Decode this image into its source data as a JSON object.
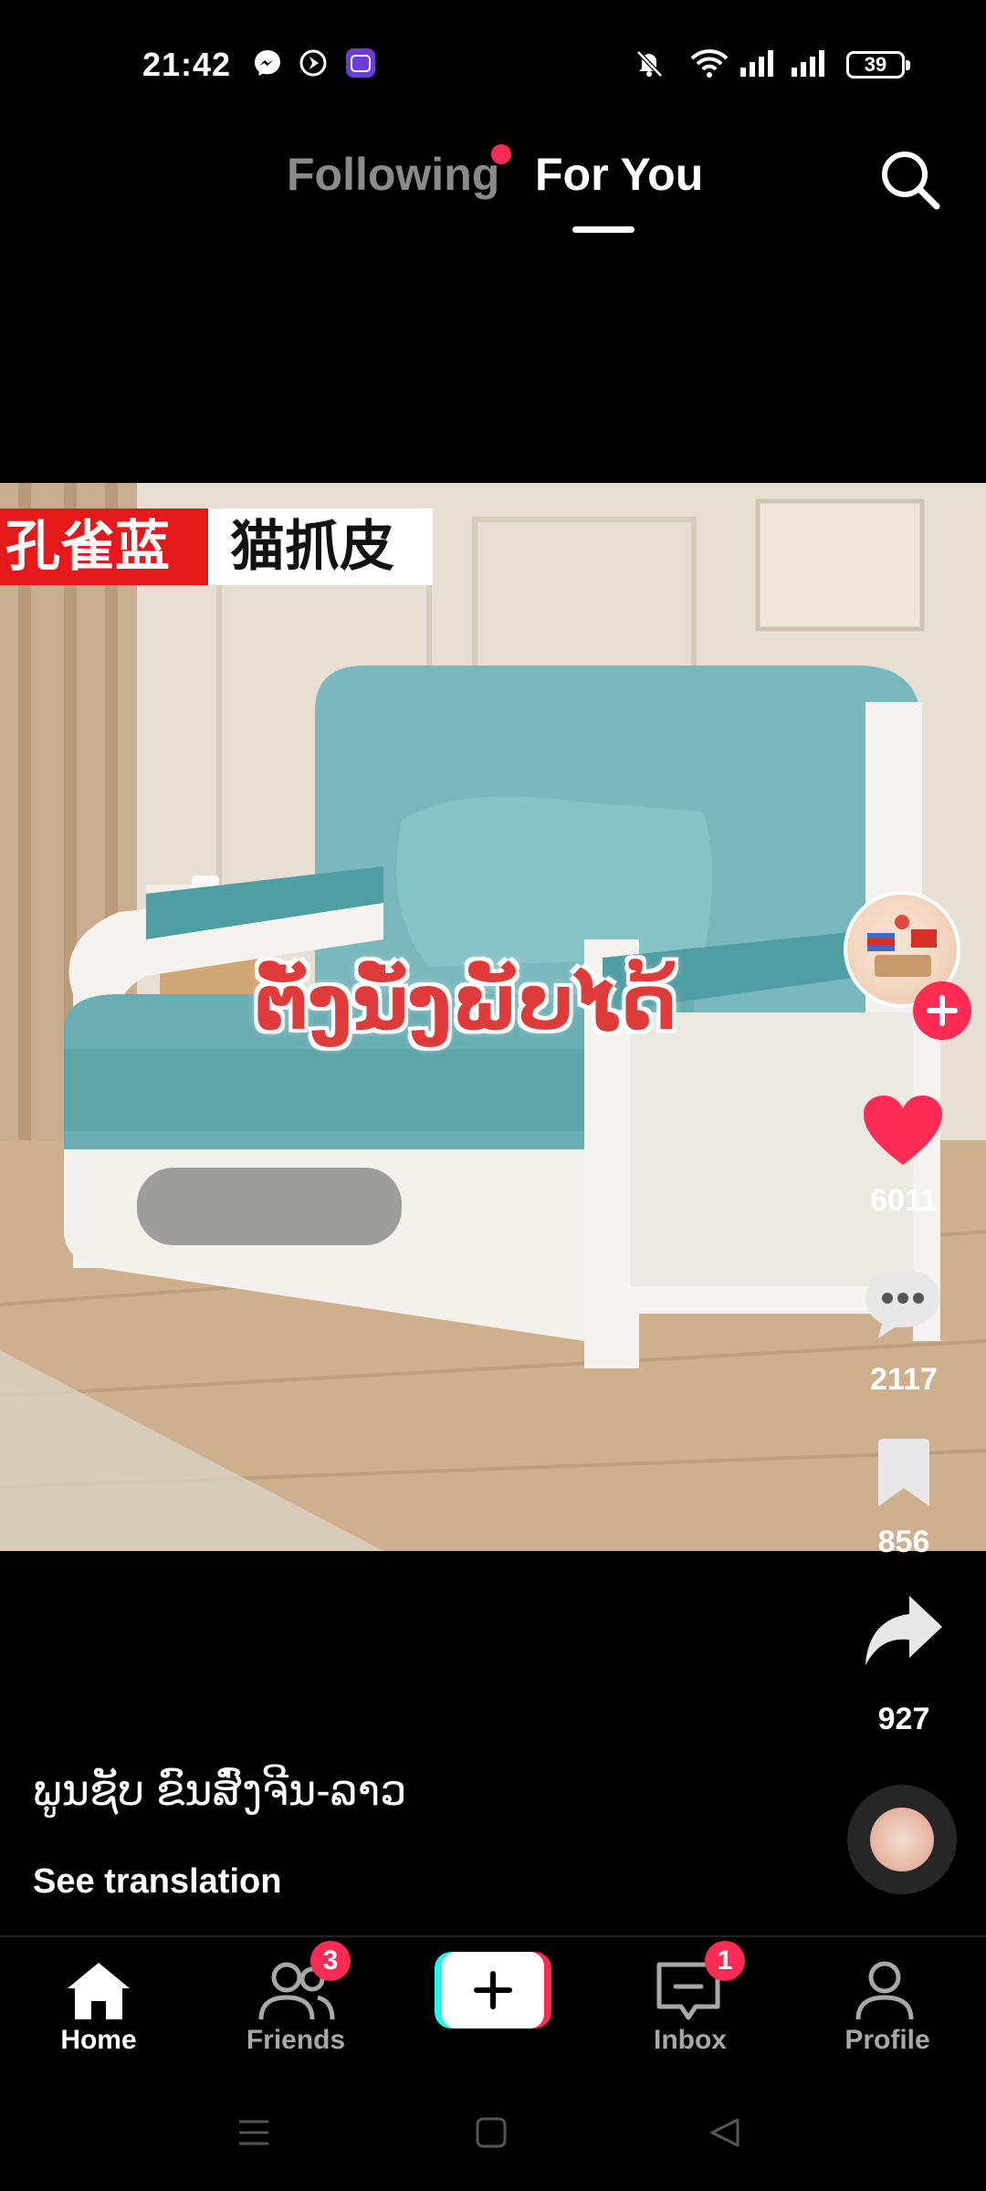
{
  "status_bar": {
    "time": "21:42",
    "battery": "39",
    "left_icons": [
      "messenger-icon",
      "navigation-icon",
      "lazada-app-icon"
    ],
    "right_icons": [
      "mute-icon",
      "wifi-icon",
      "signal-icon",
      "signal-icon",
      "battery-icon"
    ]
  },
  "top_tabs": {
    "following": "Following",
    "for_you": "For You",
    "active": "For You",
    "following_has_update": true
  },
  "video": {
    "tag_red": "孔雀蓝",
    "tag_white": "猫抓皮",
    "overlay_text": "ຕັ່ງນັ່ງພັບໄດ້"
  },
  "actions": {
    "likes": "6011",
    "comments": "2117",
    "saves": "856",
    "shares": "927",
    "like_color": "#fe2c55"
  },
  "caption": {
    "author": "ພູນຊັບ ຂົນສົ່ງຈີນ-ລາວ",
    "see_translation": "See translation"
  },
  "bottom_nav": {
    "home": "Home",
    "friends": "Friends",
    "friends_badge": "3",
    "inbox": "Inbox",
    "inbox_badge": "1",
    "profile": "Profile",
    "active": "Home"
  },
  "colors": {
    "accent": "#fe2c55",
    "create_cyan": "#25f4ee",
    "background": "#000000"
  }
}
